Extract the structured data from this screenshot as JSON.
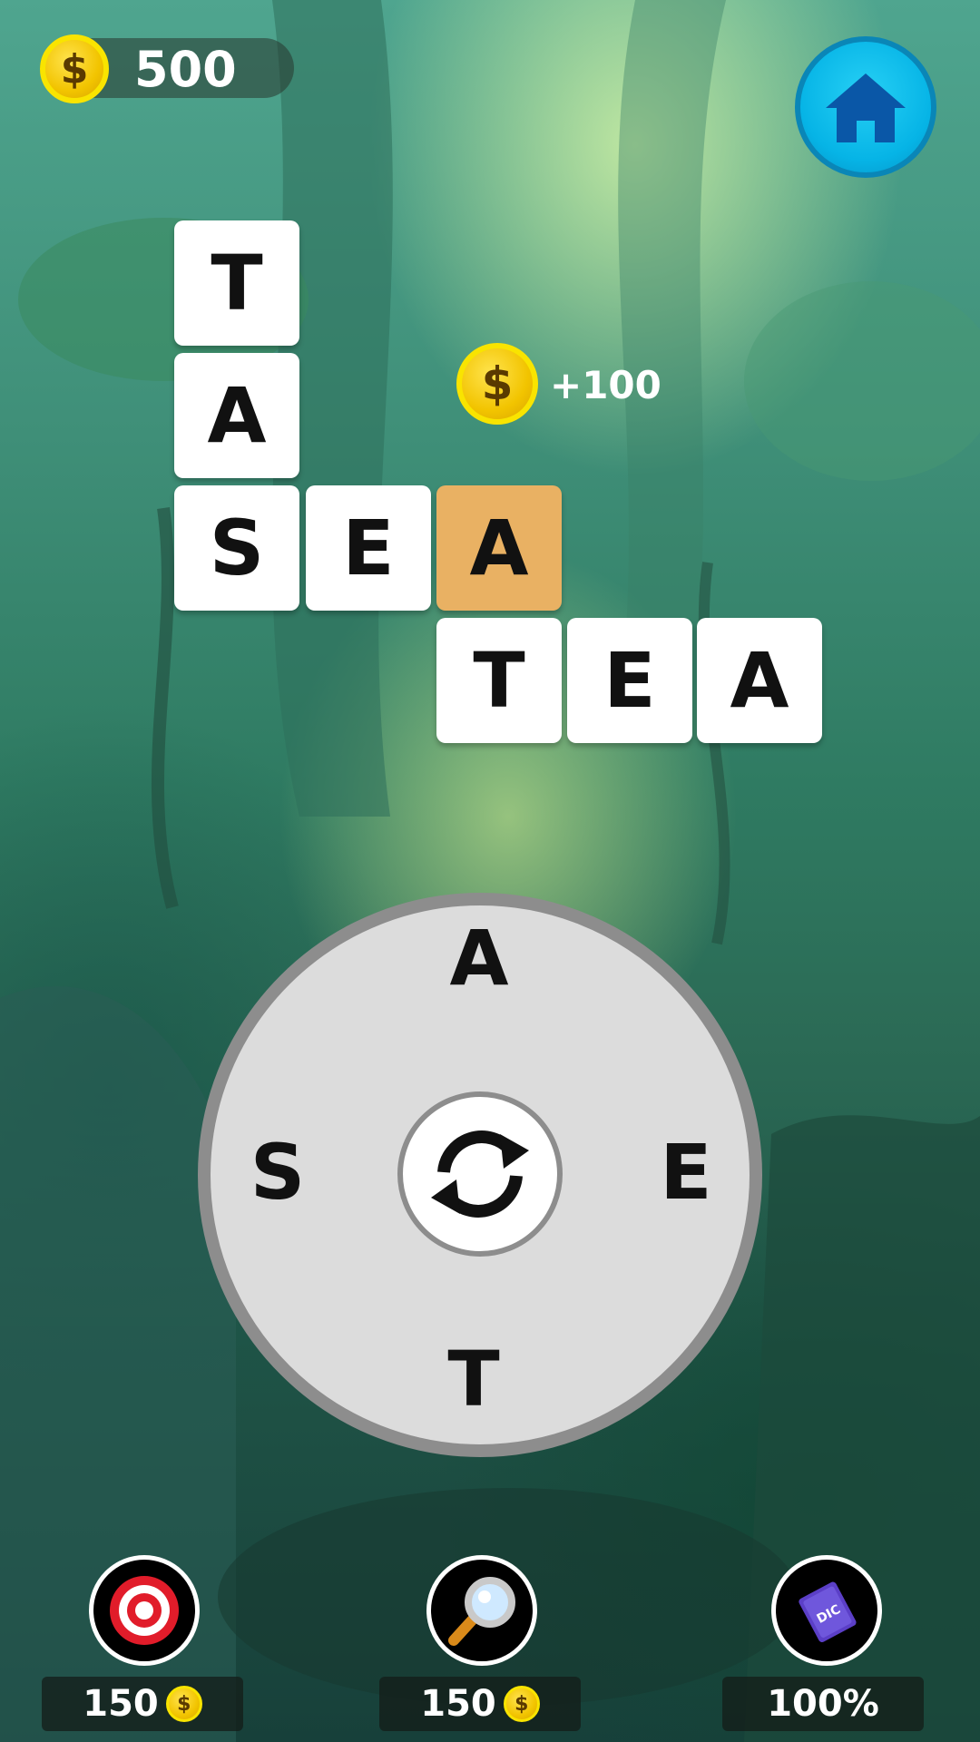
{
  "hud": {
    "coins": "500",
    "coin_symbol": "$"
  },
  "board": {
    "tiles": [
      "T",
      "A",
      "S",
      "E",
      "A",
      "T",
      "E",
      "A"
    ],
    "highlight_color": "#e9b163"
  },
  "bonus": {
    "coin_symbol": "$",
    "text": "+100"
  },
  "wheel": {
    "letters": {
      "top": "A",
      "left": "S",
      "right": "E",
      "bottom": "T"
    }
  },
  "powerups": [
    {
      "icon": "target-icon",
      "cost": "150",
      "coin_symbol": "$"
    },
    {
      "icon": "magnifier-icon",
      "cost": "150",
      "coin_symbol": "$"
    },
    {
      "icon": "dictionary-icon",
      "label": "100%",
      "book_text": "DIC"
    }
  ],
  "colors": {
    "home_button": "#06b4e6",
    "wheel_bg": "#dcdcdc",
    "wheel_border": "#8d8d8d",
    "coin": "#f2c400"
  }
}
